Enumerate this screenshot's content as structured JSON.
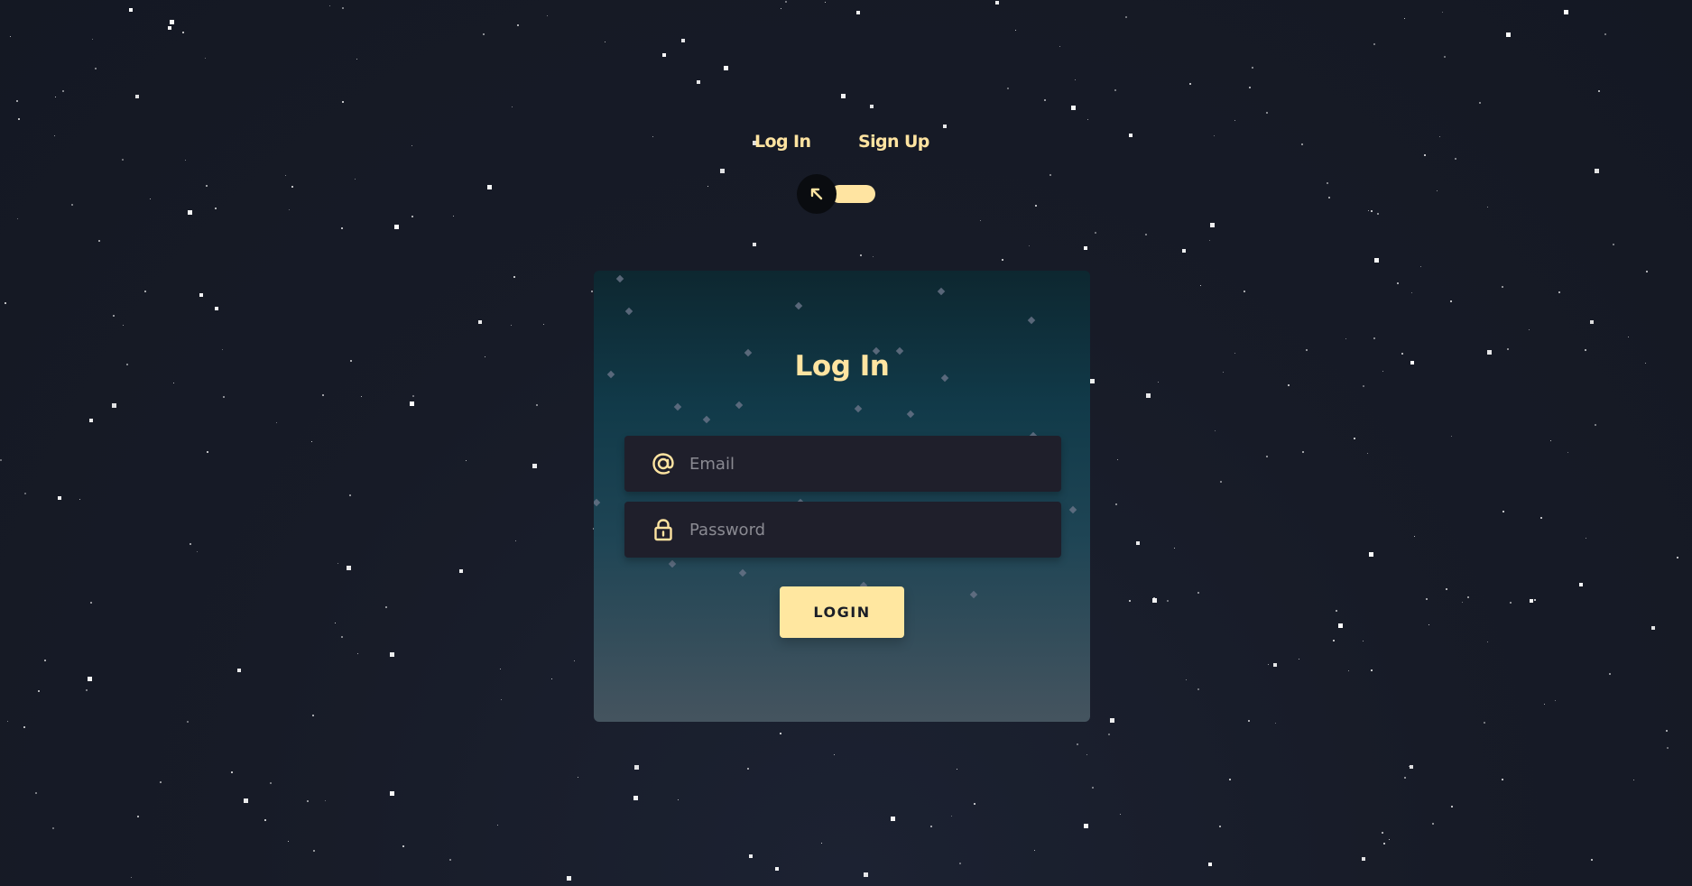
{
  "nav": {
    "login_tab": "Log In",
    "signup_tab": "Sign Up"
  },
  "toggle": {
    "icon": "arrow-up-left-icon"
  },
  "form": {
    "title": "Log In",
    "email": {
      "placeholder": "Email",
      "icon": "at-sign-icon"
    },
    "password": {
      "placeholder": "Password",
      "icon": "lock-icon"
    },
    "submit_label": "LOGIN"
  },
  "colors": {
    "accent": "#ffe4a1",
    "background": "#171b27",
    "field_background": "#1f1f2b",
    "button_text": "#1b1e27"
  }
}
